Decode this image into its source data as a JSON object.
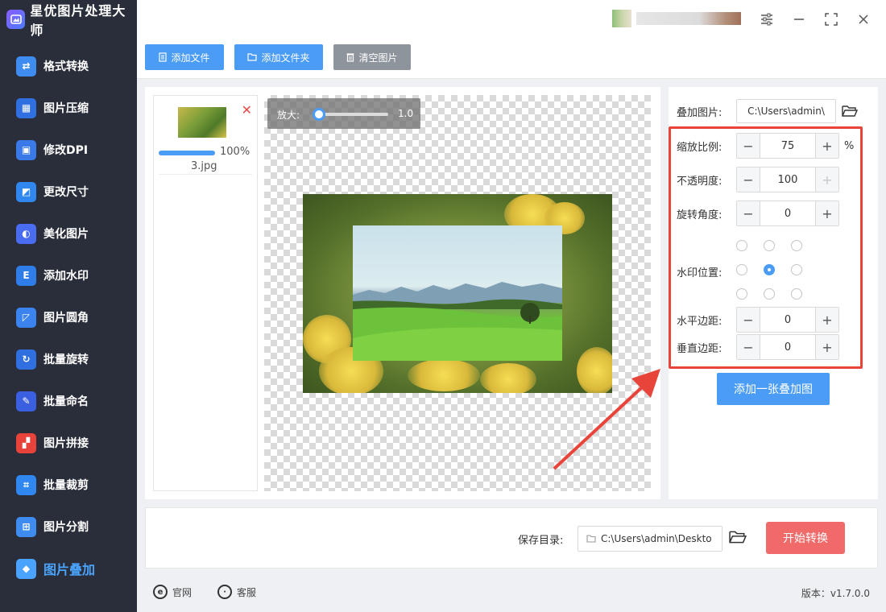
{
  "app": {
    "title": "星优图片处理大师"
  },
  "sidebar": {
    "items": [
      {
        "label": "格式转换",
        "icon": "image-convert-icon",
        "color": "#3f8cf0"
      },
      {
        "label": "图片压缩",
        "icon": "image-compress-icon",
        "color": "#2f6fe0"
      },
      {
        "label": "修改DPI",
        "icon": "dpi-icon",
        "color": "#3a7ae8"
      },
      {
        "label": "更改尺寸",
        "icon": "resize-icon",
        "color": "#2f87ef"
      },
      {
        "label": "美化图片",
        "icon": "beautify-icon",
        "color": "#4a6cf0"
      },
      {
        "label": "添加水印",
        "icon": "watermark-icon",
        "color": "#2f7de8"
      },
      {
        "label": "图片圆角",
        "icon": "round-corner-icon",
        "color": "#3b84ef"
      },
      {
        "label": "批量旋转",
        "icon": "rotate-icon",
        "color": "#2f6fe0"
      },
      {
        "label": "批量命名",
        "icon": "rename-icon",
        "color": "#3a5fe0"
      },
      {
        "label": "图片拼接",
        "icon": "stitch-icon",
        "color": "#e8433a"
      },
      {
        "label": "批量裁剪",
        "icon": "crop-icon",
        "color": "#2f87ef"
      },
      {
        "label": "图片分割",
        "icon": "split-icon",
        "color": "#3f8cf0"
      },
      {
        "label": "图片叠加",
        "icon": "layers-icon",
        "color": "#4aa3ff",
        "active": true
      }
    ]
  },
  "toolbar": {
    "add_file": "添加文件",
    "add_folder": "添加文件夹",
    "clear": "清空图片"
  },
  "file_list": [
    {
      "name": "3.jpg",
      "progress_percent": 100,
      "progress_text": "100%"
    }
  ],
  "preview": {
    "zoom_label": "放大:",
    "zoom_value": "1.0",
    "zoom_level": 1.0
  },
  "settings": {
    "overlay_image_label": "叠加图片:",
    "overlay_image_path": "C:\\Users\\admin\\",
    "scale_label": "缩放比例:",
    "scale_value": "75",
    "scale_unit": "%",
    "opacity_label": "不透明度:",
    "opacity_value": "100",
    "rotation_label": "旋转角度:",
    "rotation_value": "0",
    "position_label": "水印位置:",
    "position_selected": "center",
    "h_margin_label": "水平边距:",
    "h_margin_value": "0",
    "v_margin_label": "垂直边距:",
    "v_margin_value": "0",
    "add_overlay_button": "添加一张叠加图"
  },
  "output": {
    "save_dir_label": "保存目录:",
    "save_dir_path": "C:\\Users\\admin\\Deskto",
    "start_button": "开始转换"
  },
  "footer": {
    "website": "官网",
    "support": "客服",
    "version": "版本：v1.7.0.0"
  },
  "colors": {
    "accent": "#4a9cf5",
    "start_button": "#f06a6a",
    "highlight_frame": "#e8443a",
    "sidebar_bg": "#2a2e3a"
  }
}
